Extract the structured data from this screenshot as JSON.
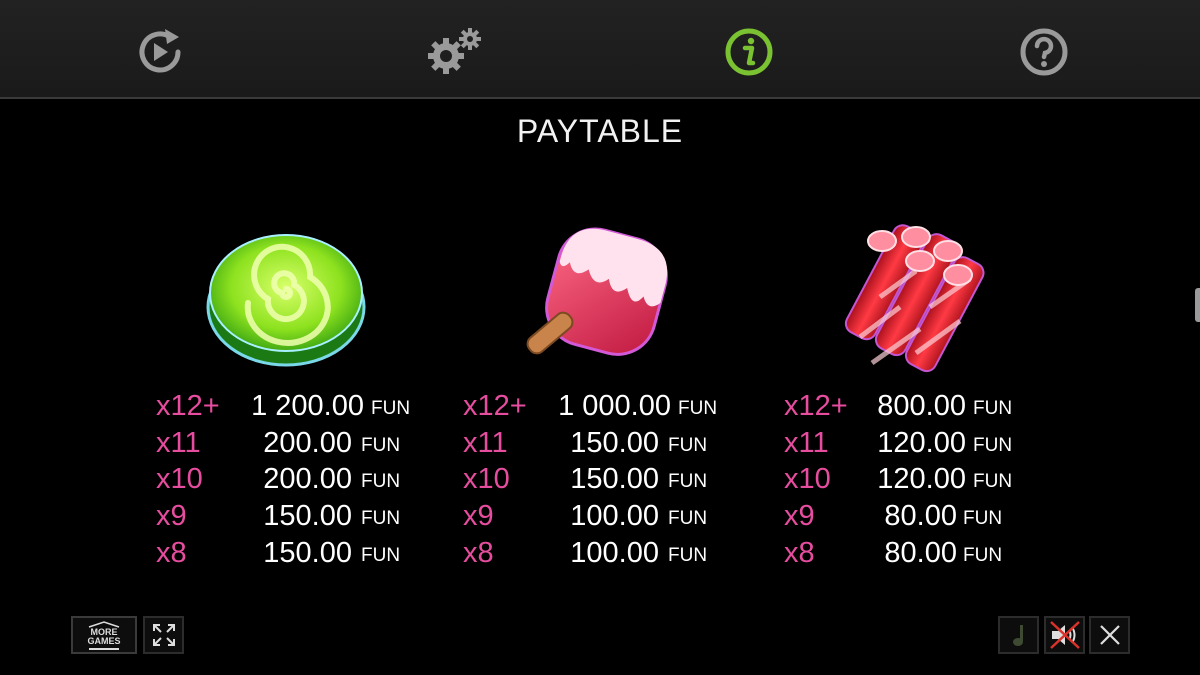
{
  "nav": {
    "items": [
      {
        "name": "replay-icon"
      },
      {
        "name": "settings-gears-icon"
      },
      {
        "name": "info-icon",
        "active": true,
        "color": "#7ac231"
      },
      {
        "name": "help-icon"
      }
    ]
  },
  "title": "PAYTABLE",
  "currency": "FUN",
  "symbols": [
    {
      "name": "lime-swirl-candy",
      "payouts": [
        {
          "mult": "x12+",
          "amount": "1 200.00"
        },
        {
          "mult": "x11",
          "amount": "200.00"
        },
        {
          "mult": "x10",
          "amount": "200.00"
        },
        {
          "mult": "x9",
          "amount": "150.00"
        },
        {
          "mult": "x8",
          "amount": "150.00"
        }
      ]
    },
    {
      "name": "popsicle",
      "payouts": [
        {
          "mult": "x12+",
          "amount": "1 000.00"
        },
        {
          "mult": "x11",
          "amount": "150.00"
        },
        {
          "mult": "x10",
          "amount": "150.00"
        },
        {
          "mult": "x9",
          "amount": "100.00"
        },
        {
          "mult": "x8",
          "amount": "100.00"
        }
      ]
    },
    {
      "name": "candy-sticks",
      "payouts": [
        {
          "mult": "x12+",
          "amount": "800.00"
        },
        {
          "mult": "x11",
          "amount": "120.00"
        },
        {
          "mult": "x10",
          "amount": "120.00"
        },
        {
          "mult": "x9",
          "amount": "80.00"
        },
        {
          "mult": "x8",
          "amount": "80.00"
        }
      ]
    }
  ],
  "bottom": {
    "more_games_label_1": "MORE",
    "more_games_label_2": "GAMES"
  },
  "colors": {
    "multiplier": "#e64d9f",
    "active_tab": "#7ac231",
    "muted_x": "#d9322b"
  }
}
